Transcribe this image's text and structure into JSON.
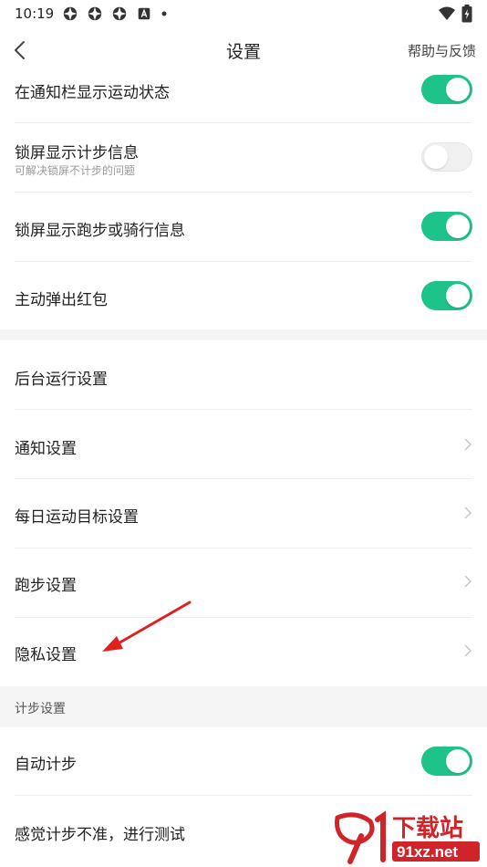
{
  "status": {
    "time": "10:19",
    "battery_level": 0.9
  },
  "header": {
    "title": "设置",
    "help": "帮助与反馈"
  },
  "toggles_top": [
    {
      "label": "在通知栏显示运动状态",
      "on": true
    },
    {
      "label": "锁屏显示计步信息",
      "sub": "可解决锁屏不计步的问题",
      "on": false
    },
    {
      "label": "锁屏显示跑步或骑行信息",
      "on": true
    },
    {
      "label": "主动弹出红包",
      "on": true
    }
  ],
  "nav_items": [
    {
      "label": "后台运行设置"
    },
    {
      "label": "通知设置"
    },
    {
      "label": "每日运动目标设置"
    },
    {
      "label": "跑步设置"
    },
    {
      "label": "隐私设置"
    }
  ],
  "section2": {
    "title": "计步设置",
    "items": [
      {
        "label": "自动计步",
        "on": true
      },
      {
        "label": "感觉计步不准，进行测试"
      }
    ]
  },
  "watermark": {
    "brand": "下载站",
    "domain": "91xz.net"
  },
  "colors": {
    "accent": "#1ec38a",
    "annotation_arrow": "#e02020"
  }
}
